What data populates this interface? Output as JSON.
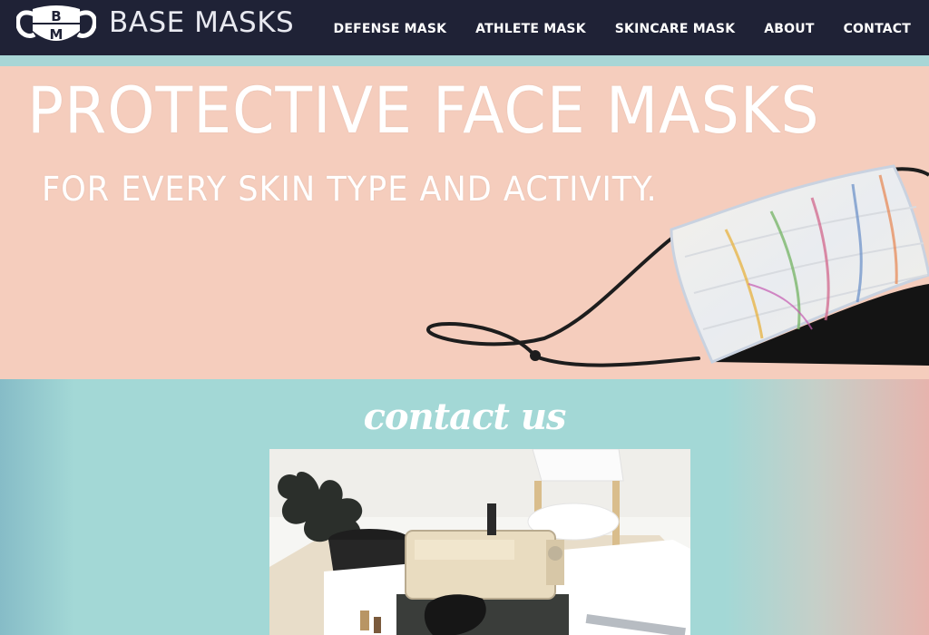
{
  "brand": {
    "name": "BASE MASKS",
    "logo_letters": [
      "B",
      "M"
    ]
  },
  "nav": {
    "items": [
      "DEFENSE MASK",
      "ATHLETE MASK",
      "SKINCARE MASK",
      "ABOUT",
      "CONTACT"
    ]
  },
  "hero": {
    "title": "PROTECTIVE FACE MASKS",
    "subtitle": "FOR EVERY SKIN TYPE AND ACTIVITY."
  },
  "contact": {
    "heading": "contact us"
  },
  "colors": {
    "header_bg": "#1f2236",
    "hero_bg": "#f5cdbd",
    "accent_teal": "#a3d8d6",
    "accent_pink": "#e6b4ad"
  },
  "icons": [
    "mask-logo-icon"
  ]
}
